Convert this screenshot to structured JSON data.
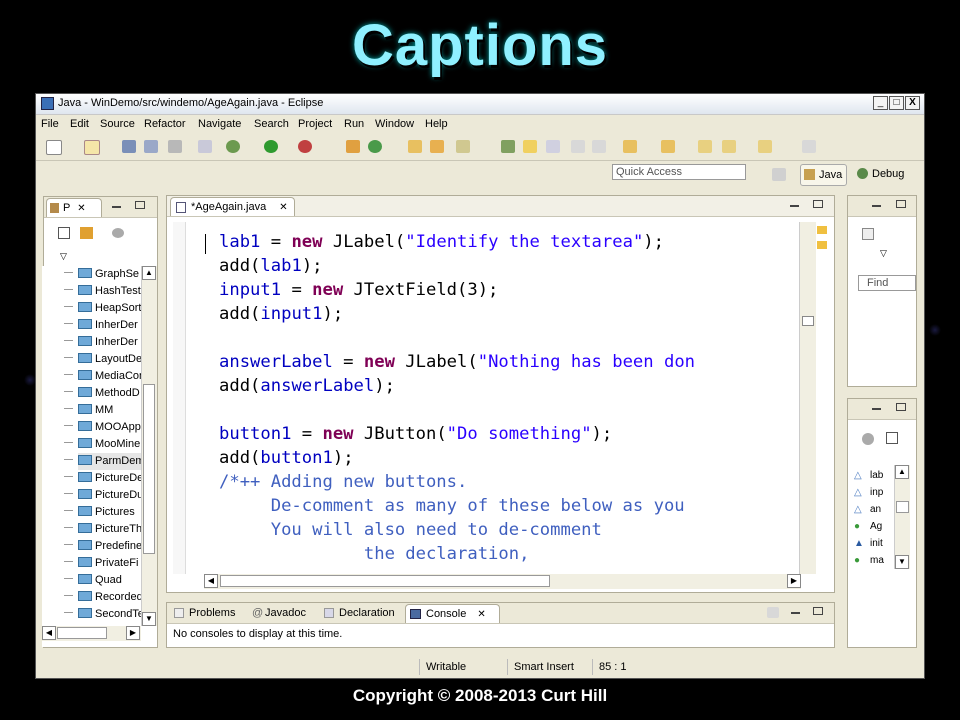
{
  "slide": {
    "title": "Captions",
    "copyright": "Copyright © 2008-2013 Curt Hill"
  },
  "window": {
    "title": "Java - WinDemo/src/windemo/AgeAgain.java - Eclipse",
    "minimize": "_",
    "maximize": "□",
    "close": "X"
  },
  "menu": [
    "File",
    "Edit",
    "Source",
    "Refactor",
    "Navigate",
    "Search",
    "Project",
    "Run",
    "Window",
    "Help"
  ],
  "quick_access": {
    "placeholder": "Quick Access"
  },
  "perspectives": {
    "java": "Java",
    "debug": "Debug"
  },
  "package_explorer": {
    "tab_label": "P",
    "items": [
      "GraphSe",
      "HashTest",
      "HeapSort",
      "InherDer",
      "InherDer",
      "LayoutDe",
      "MediaCon",
      "MethodD",
      "MM",
      "MOOApp",
      "MooMine",
      "ParmDem",
      "PictureDe",
      "PictureDu",
      "Pictures",
      "PictureTh",
      "Predefine",
      "PrivateFi",
      "Quad",
      "Recorded",
      "SecondTe"
    ]
  },
  "editor": {
    "tab_label": "*AgeAgain.java"
  },
  "outline": {
    "find_placeholder": "Find",
    "items": [
      "lab",
      "inp",
      "an",
      "Ag",
      "init",
      "ma"
    ]
  },
  "bottom_panel": {
    "tabs": [
      "Problems",
      "Javadoc",
      "Declaration",
      "Console"
    ],
    "active_tab": "Console",
    "message": "No consoles to display at this time."
  },
  "status": {
    "mode": "Writable",
    "insert": "Smart Insert",
    "position": "85 : 1"
  },
  "colors": {
    "title": "#8ff0ff",
    "keyword": "#7f0055",
    "identifier": "#0000c0",
    "string": "#2a00ff",
    "comment": "#3f5fbf"
  }
}
